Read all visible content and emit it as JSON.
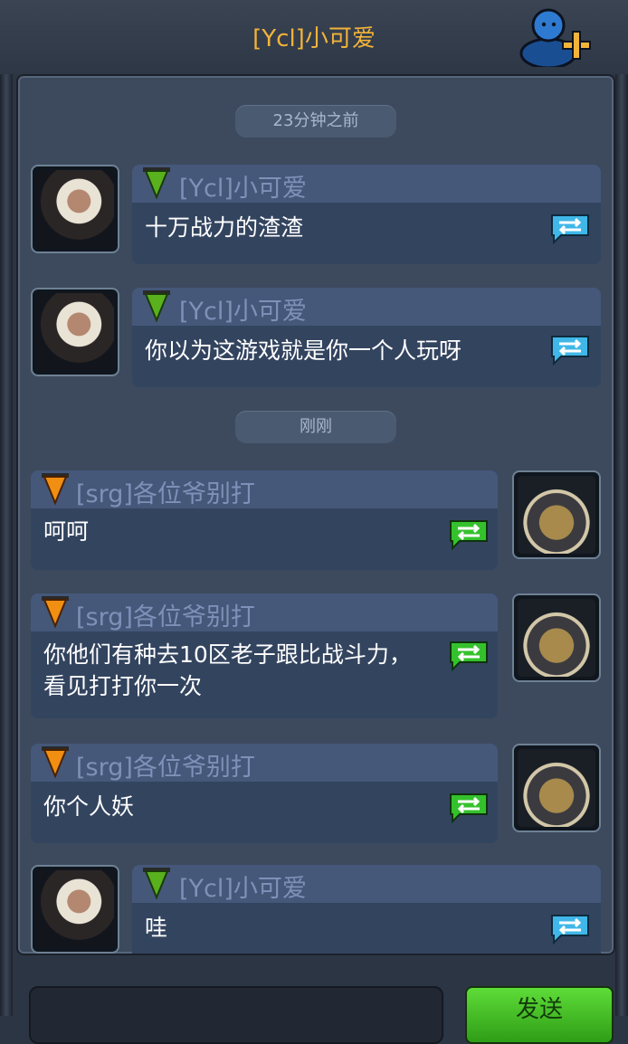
{
  "header": {
    "title": "[Ycl]小可爱"
  },
  "colors": {
    "title": "#f2b33a",
    "panel": "#3d4a5e",
    "message_bg": "#33445f",
    "name_text": "#7f91b8",
    "send_button": "#4fc12a"
  },
  "timestamps": {
    "first": "23分钟之前",
    "second": "刚刚"
  },
  "messages": [
    {
      "sender": "[Ycl]小可爱",
      "text": "十万战力的渣渣",
      "avatar": "girl-avatar",
      "badge": "green-rank-badge"
    },
    {
      "sender": "[Ycl]小可爱",
      "text": "你以为这游戏就是你一个人玩呀",
      "avatar": "girl-avatar",
      "badge": "green-rank-badge"
    },
    {
      "sender": "[srg]各位爷别打",
      "text": "呵呵",
      "avatar": "beast-avatar",
      "badge": "orange-rank-badge"
    },
    {
      "sender": "[srg]各位爷别打",
      "text_line1": "你他们有种去10区老子跟比战斗力，",
      "text_line2": "看见打打你一次",
      "avatar": "beast-avatar",
      "badge": "orange-rank-badge"
    },
    {
      "sender": "[srg]各位爷别打",
      "text": "你个人妖",
      "avatar": "beast-avatar",
      "badge": "orange-rank-badge"
    },
    {
      "sender": "[Ycl]小可爱",
      "text": "哇",
      "avatar": "girl-avatar",
      "badge": "green-rank-badge"
    }
  ],
  "footer": {
    "send_label": "发送"
  }
}
